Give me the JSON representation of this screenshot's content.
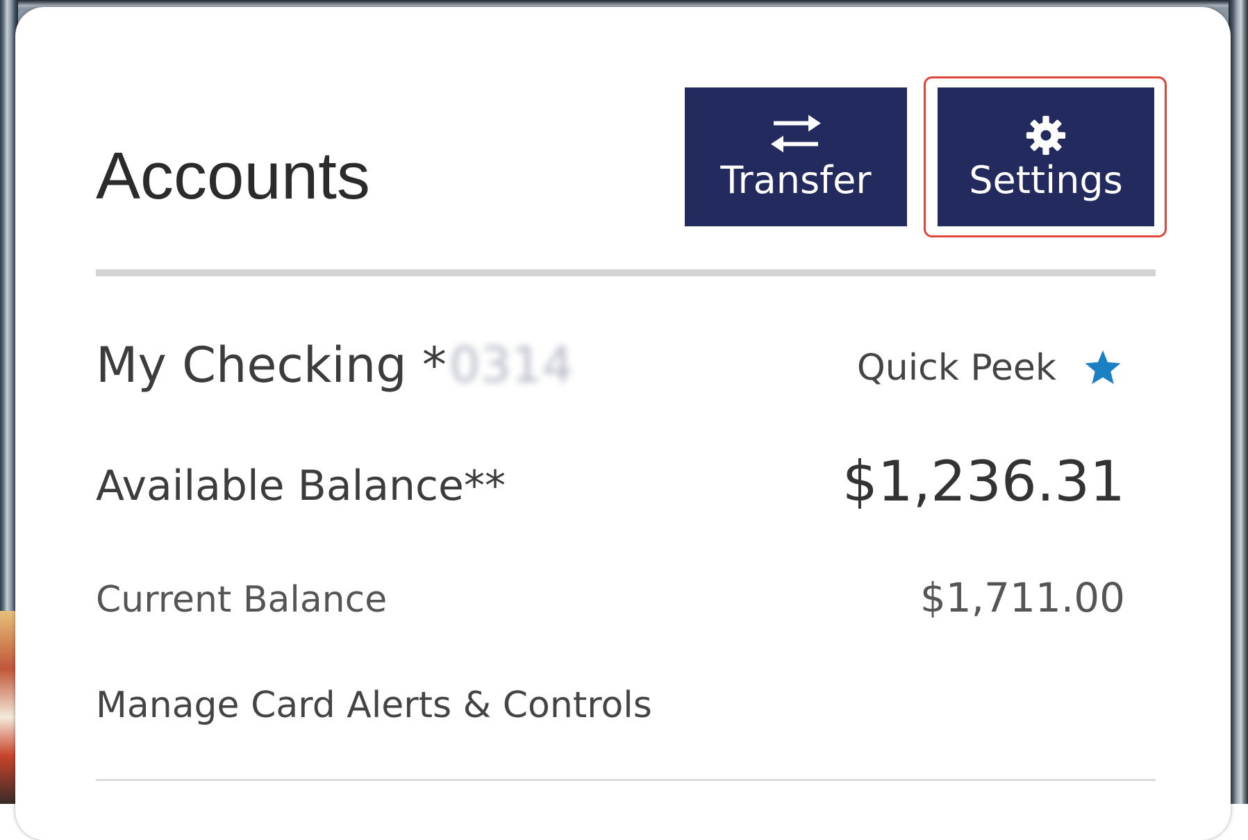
{
  "card": {
    "title": "Accounts"
  },
  "actions": {
    "transfer_label": "Transfer",
    "transfer_icon": "transfer-arrows-icon",
    "settings_label": "Settings",
    "settings_icon": "gear-icon"
  },
  "account": {
    "name": "My Checking *",
    "masked_number": "0314",
    "quick_peek_label": "Quick Peek",
    "quick_peek_icon": "star-icon",
    "star_color": "#1b7fc4",
    "available_label": "Available Balance**",
    "available_value": "$1,236.31",
    "current_label": "Current Balance",
    "current_value": "$1,711.00",
    "manage_link": "Manage Card Alerts & Controls"
  },
  "colors": {
    "button_bg": "#222a5e",
    "highlight": "#e0453a"
  }
}
